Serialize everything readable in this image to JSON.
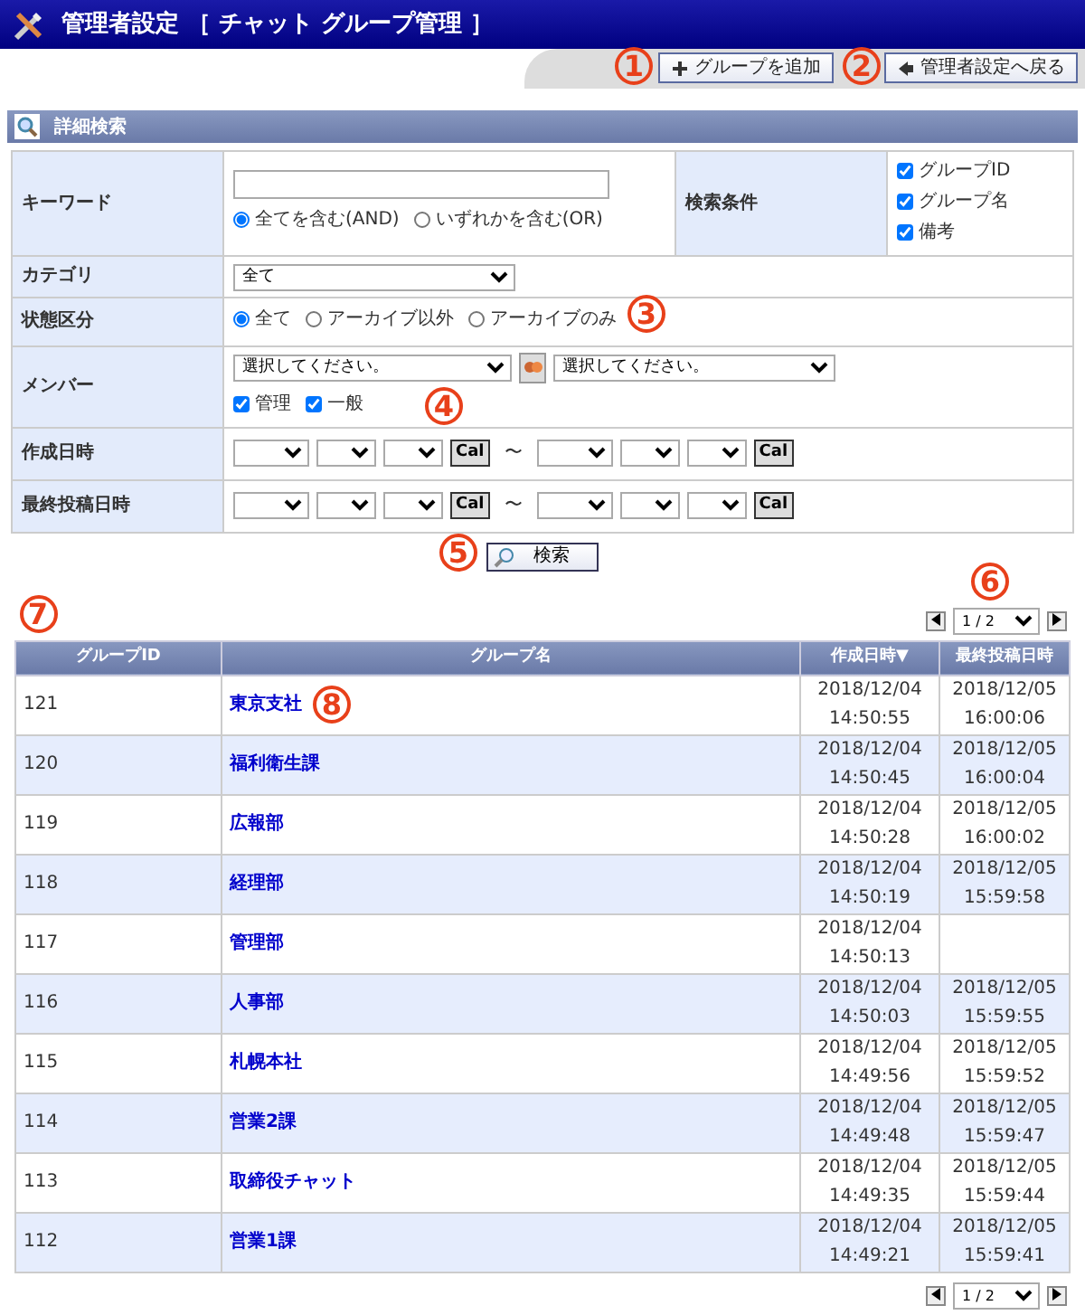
{
  "header": {
    "title": "管理者設定 ［ チャット グループ管理 ］"
  },
  "toolbar": {
    "buttons": [
      {
        "label": "グループを追加",
        "kind": "add"
      },
      {
        "label": "管理者設定へ戻る",
        "kind": "back"
      }
    ]
  },
  "search": {
    "title": "詳細検索",
    "keyword": {
      "label": "キーワード",
      "mode": [
        {
          "label": "全てを含む(AND)",
          "selected": true
        },
        {
          "label": "いずれかを含む(OR)",
          "selected": false
        }
      ]
    },
    "conditions": {
      "label": "検索条件",
      "items": [
        {
          "label": "グループID",
          "checked": true
        },
        {
          "label": "グループ名",
          "checked": true
        },
        {
          "label": "備考",
          "checked": true
        }
      ]
    },
    "category": {
      "label": "カテゴリ",
      "value": "全て"
    },
    "status": {
      "label": "状態区分",
      "options": [
        {
          "label": "全て",
          "selected": true
        },
        {
          "label": "アーカイブ以外",
          "selected": false
        },
        {
          "label": "アーカイブのみ",
          "selected": false
        }
      ]
    },
    "member": {
      "label": "メンバー",
      "first": "選択してください。",
      "second": "選択してください。",
      "roles": [
        {
          "label": "管理",
          "checked": true
        },
        {
          "label": "一般",
          "checked": true
        }
      ]
    },
    "dates": [
      {
        "label": "作成日時",
        "cal_start": "Cal",
        "sep": "〜",
        "cal_end": "Cal"
      },
      {
        "label": "最終投稿日時",
        "cal_start": "Cal",
        "sep": "〜",
        "cal_end": "Cal"
      }
    ],
    "button": "検索"
  },
  "pager": {
    "value": "1 / 2"
  },
  "table": {
    "columns": [
      {
        "label": "グループID"
      },
      {
        "label": "グループ名"
      },
      {
        "label": "作成日時▼"
      },
      {
        "label": "最終投稿日時"
      }
    ],
    "rows": [
      {
        "id": "121",
        "name": "東京支社",
        "created": [
          "2018/12/04",
          "14:50:55"
        ],
        "last": [
          "2018/12/05",
          "16:00:06"
        ]
      },
      {
        "id": "120",
        "name": "福利衛生課",
        "created": [
          "2018/12/04",
          "14:50:45"
        ],
        "last": [
          "2018/12/05",
          "16:00:04"
        ]
      },
      {
        "id": "119",
        "name": "広報部",
        "created": [
          "2018/12/04",
          "14:50:28"
        ],
        "last": [
          "2018/12/05",
          "16:00:02"
        ]
      },
      {
        "id": "118",
        "name": "経理部",
        "created": [
          "2018/12/04",
          "14:50:19"
        ],
        "last": [
          "2018/12/05",
          "15:59:58"
        ]
      },
      {
        "id": "117",
        "name": "管理部",
        "created": [
          "2018/12/04",
          "14:50:13"
        ]
      },
      {
        "id": "116",
        "name": "人事部",
        "created": [
          "2018/12/04",
          "14:50:03"
        ],
        "last": [
          "2018/12/05",
          "15:59:55"
        ]
      },
      {
        "id": "115",
        "name": "札幌本社",
        "created": [
          "2018/12/04",
          "14:49:56"
        ],
        "last": [
          "2018/12/05",
          "15:59:52"
        ]
      },
      {
        "id": "114",
        "name": "営業2課",
        "created": [
          "2018/12/04",
          "14:49:48"
        ],
        "last": [
          "2018/12/05",
          "15:59:47"
        ]
      },
      {
        "id": "113",
        "name": "取締役チャット",
        "created": [
          "2018/12/04",
          "14:49:35"
        ],
        "last": [
          "2018/12/05",
          "15:59:44"
        ]
      },
      {
        "id": "112",
        "name": "営業1課",
        "created": [
          "2018/12/04",
          "14:49:21"
        ],
        "last": [
          "2018/12/05",
          "15:59:41"
        ]
      }
    ]
  },
  "bottom_pager": {
    "value": "1 / 2"
  },
  "callouts": [
    "1",
    "2",
    "3",
    "4",
    "5",
    "6",
    "7",
    "8"
  ]
}
